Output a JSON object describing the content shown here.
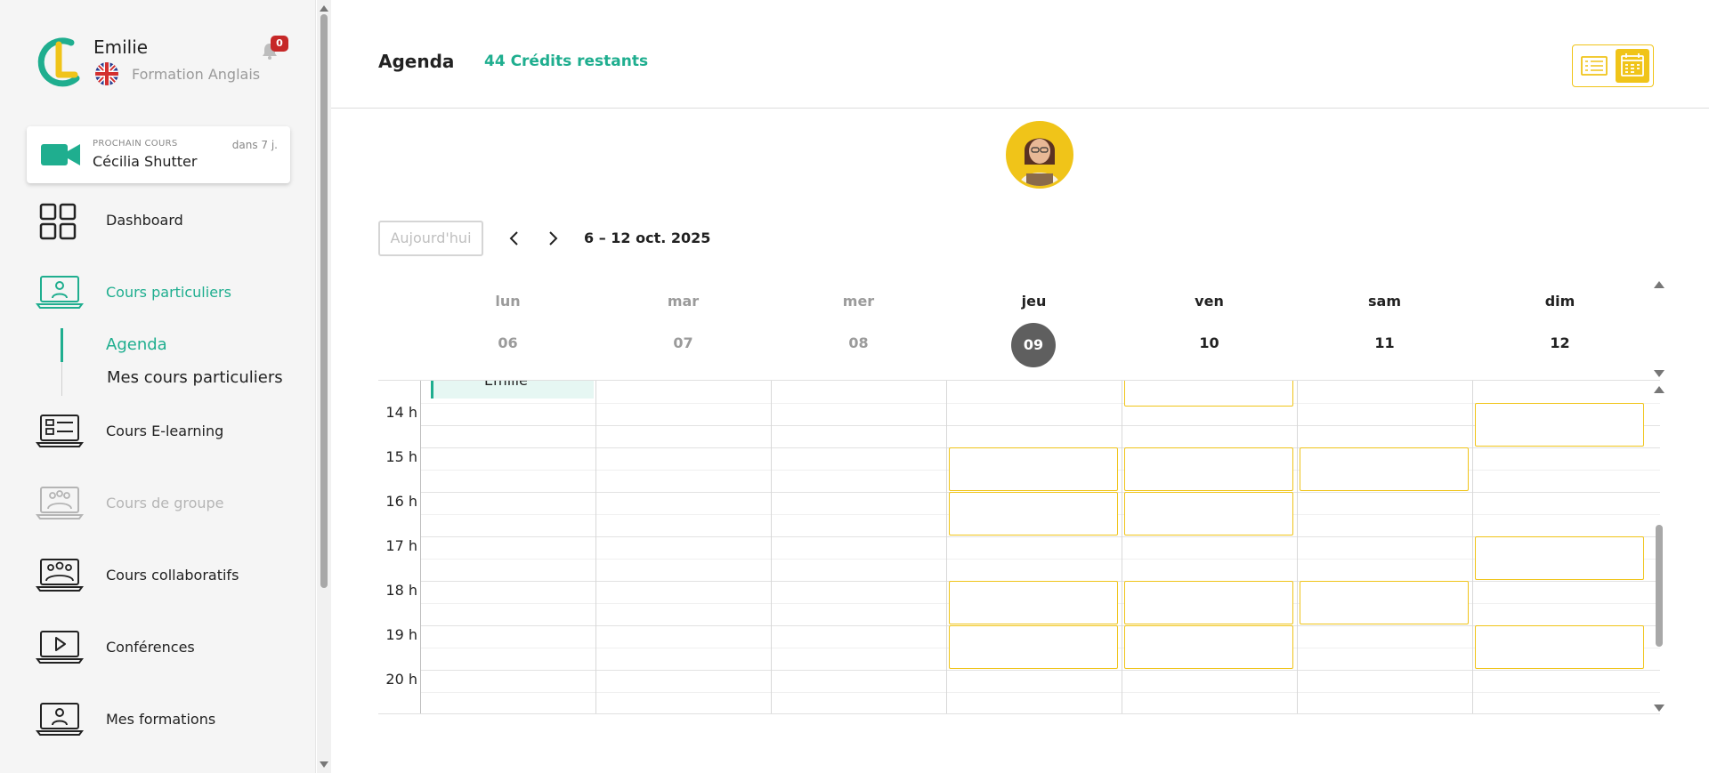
{
  "profile": {
    "name": "Emilie",
    "formation": "Formation Anglais",
    "notif_count": "0"
  },
  "next_course": {
    "label": "PROCHAIN COURS",
    "teacher": "Cécilia Shutter",
    "when": "dans 7 j."
  },
  "nav": {
    "dashboard": "Dashboard",
    "cours_particuliers": "Cours particuliers",
    "agenda": "Agenda",
    "mes_cours": "Mes cours particuliers",
    "elearning": "Cours E-learning",
    "groupe": "Cours de groupe",
    "collaboratifs": "Cours collaboratifs",
    "conferences": "Conférences",
    "formations": "Mes formations"
  },
  "header": {
    "title": "Agenda",
    "credits": "44 Crédits restants"
  },
  "toolbar": {
    "today": "Aujourd'hui",
    "range": "6 – 12 oct. 2025"
  },
  "days": [
    {
      "name": "lun",
      "date": "06"
    },
    {
      "name": "mar",
      "date": "07"
    },
    {
      "name": "mer",
      "date": "08"
    },
    {
      "name": "jeu",
      "date": "09"
    },
    {
      "name": "ven",
      "date": "10"
    },
    {
      "name": "sam",
      "date": "11"
    },
    {
      "name": "dim",
      "date": "12"
    }
  ],
  "hours": [
    "14 h",
    "15 h",
    "16 h",
    "17 h",
    "18 h",
    "19 h",
    "20 h"
  ],
  "event": {
    "title": "Emilie"
  },
  "colors": {
    "accent": "#1fae8f",
    "slot": "#f0c419",
    "badge": "#c62828"
  }
}
